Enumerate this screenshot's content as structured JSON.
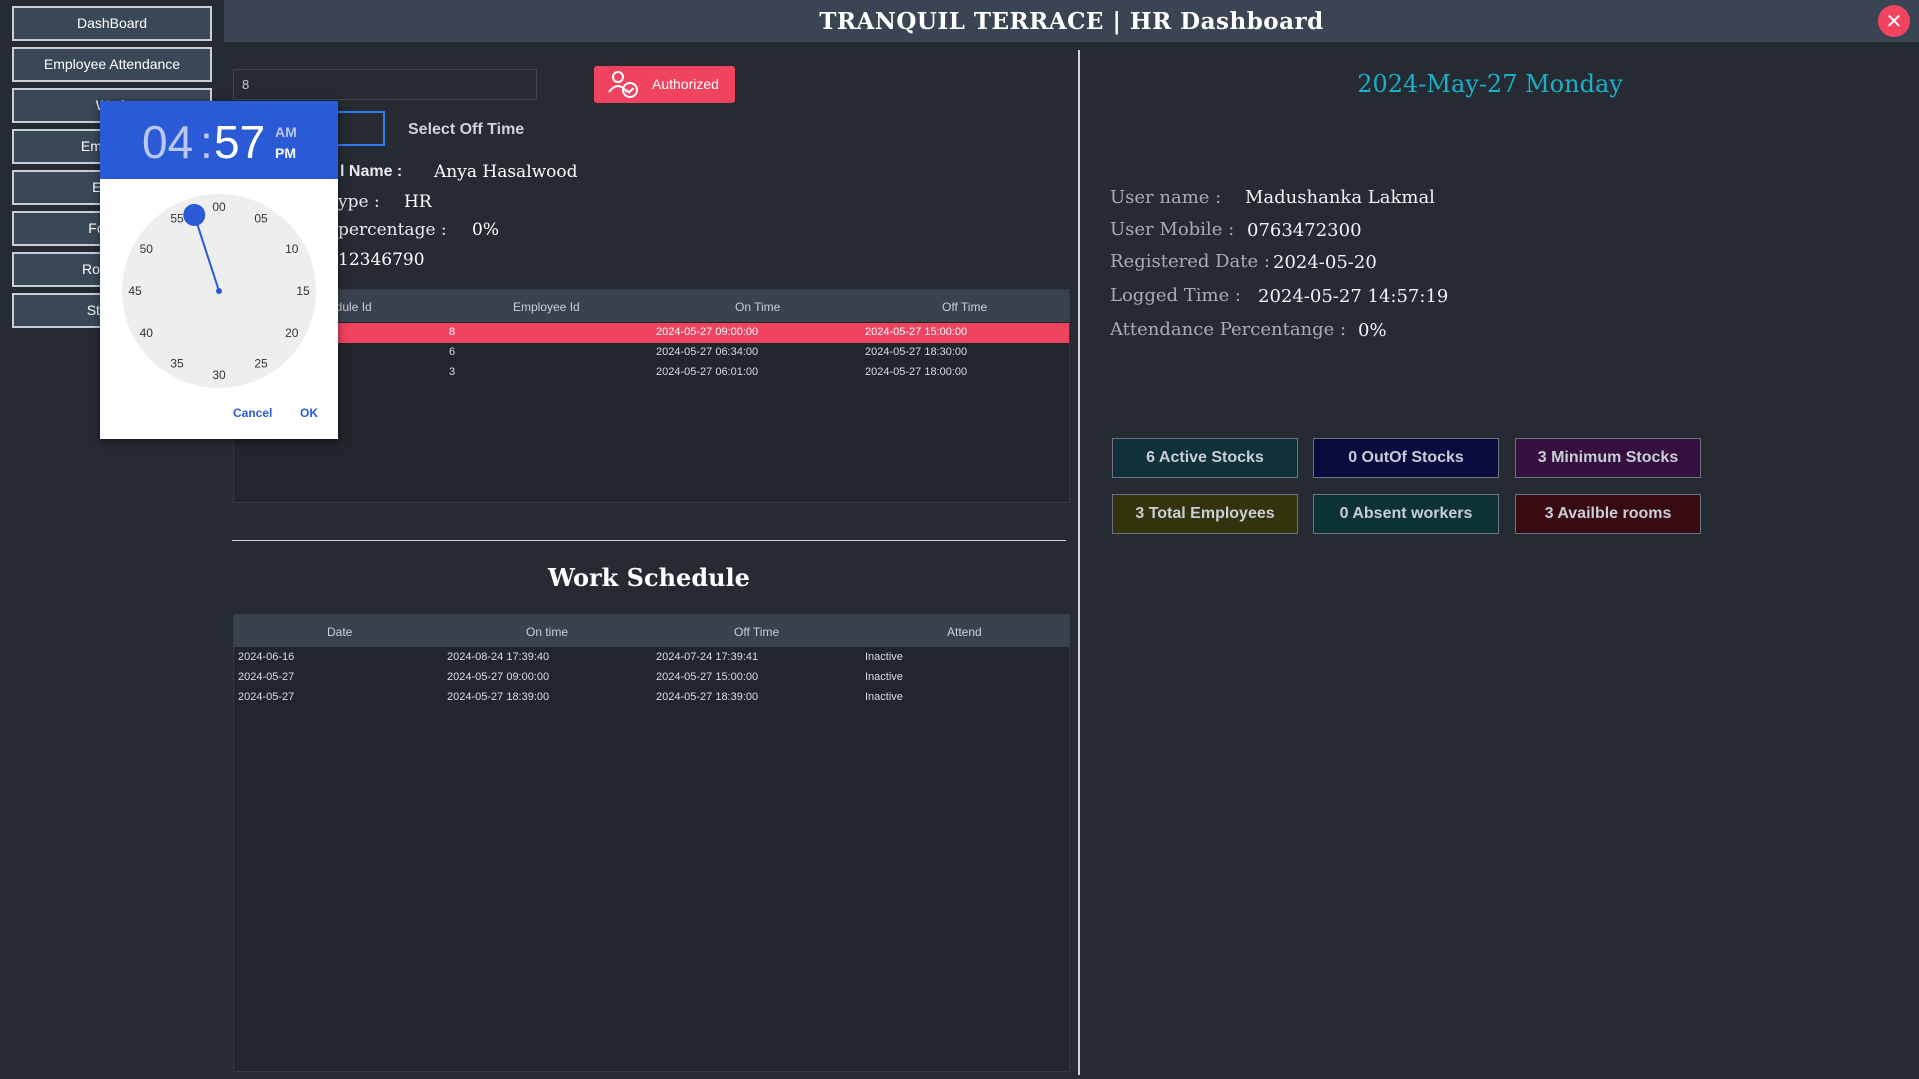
{
  "header": {
    "title": "TRANQUIL TERRACE | HR Dashboard",
    "close_icon": "close-icon"
  },
  "sidebar": {
    "items": [
      {
        "label": "DashBoard"
      },
      {
        "label": "Employee Attendance"
      },
      {
        "label": "Work"
      },
      {
        "label": "Employee"
      },
      {
        "label": "Emplo"
      },
      {
        "label": "Food M"
      },
      {
        "label": "Rooms M"
      },
      {
        "label": "Stock M"
      }
    ]
  },
  "form": {
    "search_value": "8",
    "authorized_label": "Authorized",
    "select_off_time_label": "Select Off Time",
    "name_label": "l Name :",
    "name_value": "Anya Hasalwood",
    "type_label": "ype :",
    "type_value": "HR",
    "percentage_label": "percentage :",
    "percentage_value": "0%",
    "phone_value": "12346790"
  },
  "schedule_table": {
    "headers": [
      "edule Id",
      "Employee Id",
      "On Time",
      "Off Time"
    ],
    "rows": [
      {
        "schedule_id": "8",
        "on_time": "2024-05-27 09:00:00",
        "off_time": "2024-05-27 15:00:00",
        "selected": true
      },
      {
        "schedule_id": "6",
        "on_time": "2024-05-27 06:34:00",
        "off_time": "2024-05-27 18:30:00",
        "selected": false
      },
      {
        "schedule_id": "3",
        "on_time": "2024-05-27 06:01:00",
        "off_time": "2024-05-27 18:00:00",
        "selected": false
      }
    ]
  },
  "work_schedule": {
    "title": "Work Schedule",
    "headers": [
      "Date",
      "On time",
      "Off Time",
      "Attend"
    ],
    "rows": [
      {
        "date": "2024-06-16",
        "on_time": "2024-08-24 17:39:40",
        "off_time": "2024-07-24 17:39:41",
        "attend": "Inactive"
      },
      {
        "date": "2024-05-27",
        "on_time": "2024-05-27 09:00:00",
        "off_time": "2024-05-27 15:00:00",
        "attend": "Inactive"
      },
      {
        "date": "2024-05-27",
        "on_time": "2024-05-27 18:39:00",
        "off_time": "2024-05-27 18:39:00",
        "attend": "Inactive"
      }
    ]
  },
  "right_panel": {
    "date": "2024-May-27  Monday",
    "user_name_label": "User name :",
    "user_name": "Madushanka Lakmal",
    "user_mobile_label": "User Mobile :",
    "user_mobile": "0763472300",
    "registered_label": "Registered Date :",
    "registered_date": "2024-05-20",
    "logged_label": "Logged Time :",
    "logged_time": "2024-05-27  14:57:19",
    "attendance_label": "Attendance Percentange :",
    "attendance_value": "0%"
  },
  "stats": [
    {
      "label": "6 Active Stocks",
      "color": "#10313a"
    },
    {
      "label": "0 OutOf Stocks",
      "color": "#0a0a3e"
    },
    {
      "label": "3 Minimum Stocks",
      "color": "#35103f"
    },
    {
      "label": "3 Total Employees",
      "color": "#33340e"
    },
    {
      "label": "0 Absent workers",
      "color": "#0d3236"
    },
    {
      "label": "3 Availble rooms",
      "color": "#3a0a12"
    }
  ],
  "time_picker": {
    "hour": "04",
    "colon": ":",
    "minute": "57",
    "am": "AM",
    "pm": "PM",
    "dial_labels": [
      "00",
      "05",
      "10",
      "15",
      "20",
      "25",
      "30",
      "35",
      "40",
      "45",
      "50",
      "55"
    ],
    "cancel": "Cancel",
    "ok": "OK",
    "selected_minute": 57
  },
  "colors": {
    "accent": "#f0435f",
    "picker_blue": "#2a5ad6",
    "date_cyan": "#1ab0c8"
  }
}
